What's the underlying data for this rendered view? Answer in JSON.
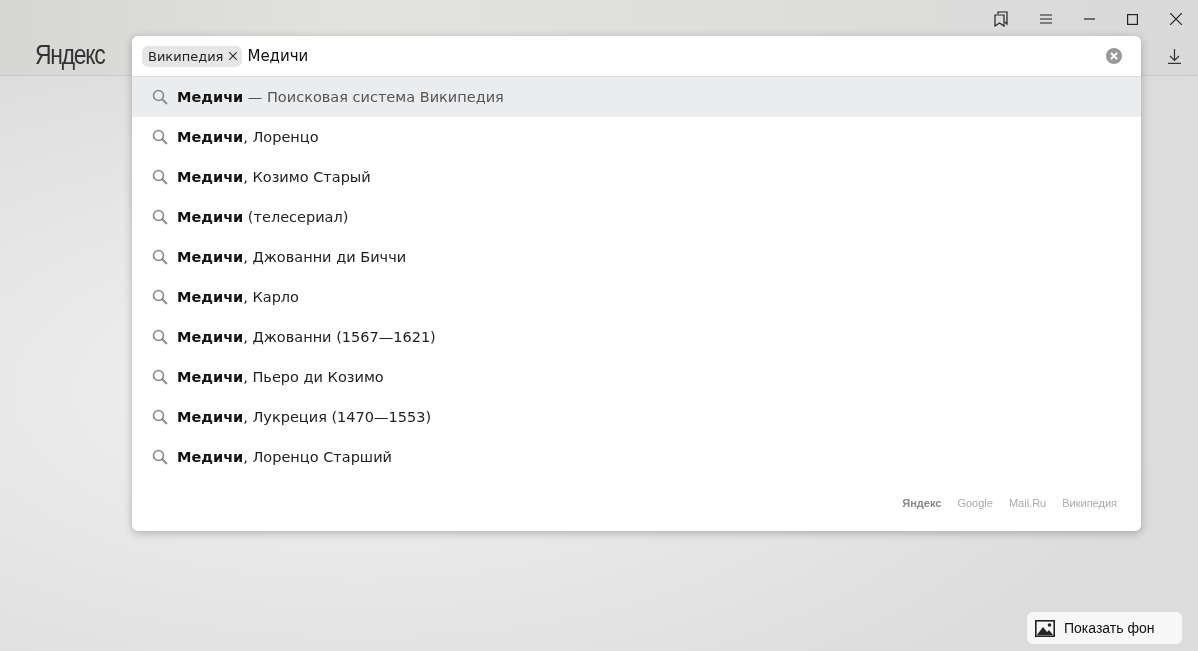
{
  "logo": "Яндекс",
  "search": {
    "scope_tag": "Википедия",
    "value": "Медичи"
  },
  "suggestions": [
    {
      "query": "Медичи",
      "rest": " — Поисковая система Википедия",
      "kind": "engine",
      "selected": true
    },
    {
      "query": "Медичи",
      "rest": ", Лоренцо",
      "kind": "plain",
      "selected": false
    },
    {
      "query": "Медичи",
      "rest": ", Козимо Старый",
      "kind": "plain",
      "selected": false
    },
    {
      "query": "Медичи",
      "rest": " (телесериал)",
      "kind": "plain",
      "selected": false
    },
    {
      "query": "Медичи",
      "rest": ", Джованни ди Биччи",
      "kind": "plain",
      "selected": false
    },
    {
      "query": "Медичи",
      "rest": ", Карло",
      "kind": "plain",
      "selected": false
    },
    {
      "query": "Медичи",
      "rest": ", Джованни (1567—1621)",
      "kind": "plain",
      "selected": false
    },
    {
      "query": "Медичи",
      "rest": ", Пьеро ди Козимо",
      "kind": "plain",
      "selected": false
    },
    {
      "query": "Медичи",
      "rest": ", Лукреция (1470—1553)",
      "kind": "plain",
      "selected": false
    },
    {
      "query": "Медичи",
      "rest": ", Лоренцо Старший",
      "kind": "plain",
      "selected": false
    }
  ],
  "engines": [
    {
      "label": "Яндекс",
      "selected": true
    },
    {
      "label": "Google",
      "selected": false
    },
    {
      "label": "Mail.Ru",
      "selected": false
    },
    {
      "label": "Википедия",
      "selected": false
    }
  ],
  "show_background_button": "Показать фон"
}
